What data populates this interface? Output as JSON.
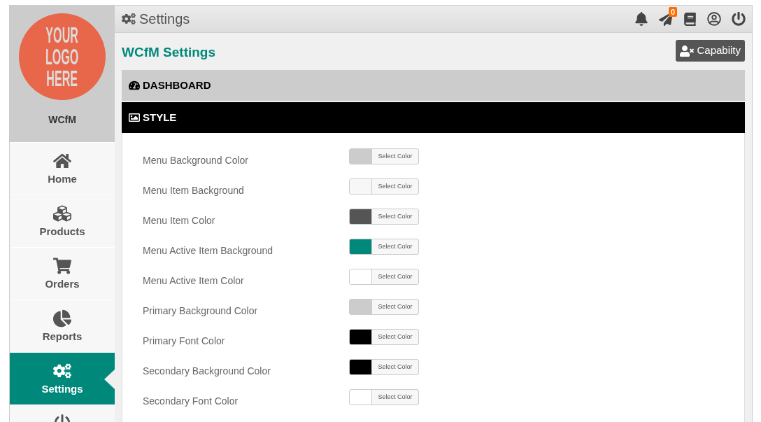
{
  "header": {
    "title": "Settings",
    "notification_count": "0"
  },
  "sidebar": {
    "logo_lines": [
      "YOUR",
      "LOGO",
      "HERE"
    ],
    "brand": "WCfM",
    "items": [
      {
        "label": "Home",
        "selected": false
      },
      {
        "label": "Products",
        "selected": false
      },
      {
        "label": "Orders",
        "selected": false
      },
      {
        "label": "Reports",
        "selected": false
      },
      {
        "label": "Settings",
        "selected": true
      },
      {
        "selected": false
      }
    ]
  },
  "page": {
    "title": "WCfM Settings",
    "capability_button": "Capabiity"
  },
  "sections": [
    {
      "title": "DASHBOARD",
      "expanded": false
    },
    {
      "title": "STYLE",
      "expanded": true,
      "rows": [
        {
          "label": "Menu Background Color",
          "color": "#cccccc",
          "button": "Select Color"
        },
        {
          "label": "Menu Item Background",
          "color": "#f7f7f7",
          "button": "Select Color"
        },
        {
          "label": "Menu Item Color",
          "color": "#555555",
          "button": "Select Color"
        },
        {
          "label": "Menu Active Item Background",
          "color": "#00897b",
          "button": "Select Color"
        },
        {
          "label": "Menu Active Item Color",
          "color": "#ffffff",
          "button": "Select Color"
        },
        {
          "label": "Primary Background Color",
          "color": "#cccccc",
          "button": "Select Color"
        },
        {
          "label": "Primary Font Color",
          "color": "#000000",
          "button": "Select Color"
        },
        {
          "label": "Secondary Background Color",
          "color": "#000000",
          "button": "Select Color"
        },
        {
          "label": "Secondary Font Color",
          "color": "#ffffff",
          "button": "Select Color"
        }
      ]
    }
  ]
}
